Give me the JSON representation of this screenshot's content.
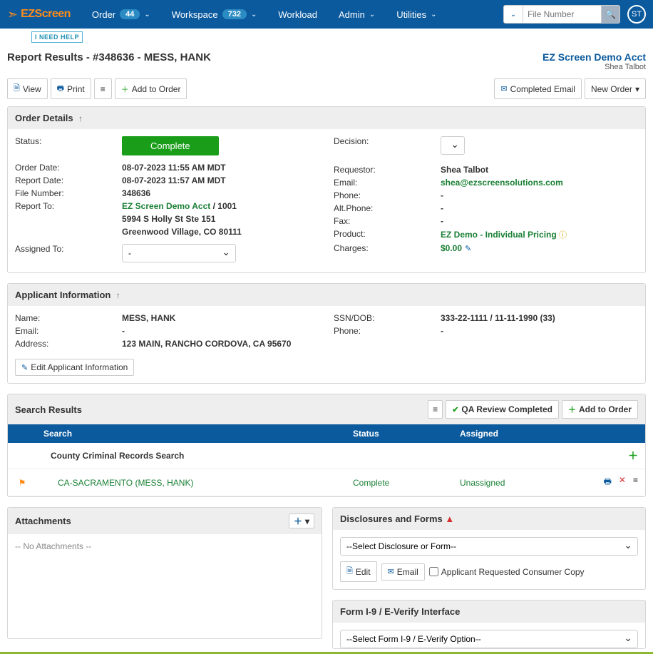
{
  "nav": {
    "logo": "EZScreen",
    "items": [
      {
        "label": "Order",
        "badge": "44"
      },
      {
        "label": "Workspace",
        "badge": "732"
      },
      {
        "label": "Workload"
      },
      {
        "label": "Admin"
      },
      {
        "label": "Utilities"
      }
    ],
    "search_placeholder": "File Number",
    "avatar": "ST"
  },
  "help_btn": "I NEED HELP",
  "page": {
    "title": "Report Results - #348636 - MESS, HANK",
    "account": "EZ Screen Demo Acct",
    "user": "Shea Talbot"
  },
  "toolbar": {
    "view": "View",
    "print": "Print",
    "add_to_order": "Add to Order",
    "completed_email": "Completed Email",
    "new_order": "New Order"
  },
  "order_details": {
    "title": "Order Details",
    "left": {
      "status_lbl": "Status:",
      "status_val": "Complete",
      "order_date_lbl": "Order Date:",
      "order_date_val": "08-07-2023 11:55 AM MDT",
      "report_date_lbl": "Report Date:",
      "report_date_val": "08-07-2023 11:57 AM MDT",
      "file_lbl": "File Number:",
      "file_val": "348636",
      "report_to_lbl": "Report To:",
      "report_to_acct": "EZ Screen Demo Acct",
      "report_to_rest": " / 1001",
      "addr1": "5994 S Holly St Ste 151",
      "addr2": "Greenwood Village, CO 80111",
      "assigned_lbl": "Assigned To:",
      "assigned_val": "-"
    },
    "right": {
      "decision_lbl": "Decision:",
      "requestor_lbl": "Requestor:",
      "requestor_val": "Shea Talbot",
      "email_lbl": "Email:",
      "email_val": "shea@ezscreensolutions.com",
      "phone_lbl": "Phone:",
      "phone_val": "-",
      "altphone_lbl": "Alt.Phone:",
      "altphone_val": "-",
      "fax_lbl": "Fax:",
      "fax_val": "-",
      "product_lbl": "Product:",
      "product_val": "EZ Demo - Individual Pricing",
      "charges_lbl": "Charges:",
      "charges_val": "$0.00"
    }
  },
  "applicant": {
    "title": "Applicant Information",
    "name_lbl": "Name:",
    "name_val": "MESS, HANK",
    "email_lbl": "Email:",
    "email_val": "-",
    "address_lbl": "Address:",
    "address_val": "123 MAIN, RANCHO CORDOVA, CA 95670",
    "ssn_lbl": "SSN/DOB:",
    "ssn_val": "333-22-1111 / 11-11-1990 (33)",
    "phone_lbl": "Phone:",
    "phone_val": "-",
    "edit_btn": "Edit Applicant Information"
  },
  "search_results": {
    "title": "Search Results",
    "qa_btn": "QA Review Completed",
    "add_btn": "Add to Order",
    "cols": {
      "search": "Search",
      "status": "Status",
      "assigned": "Assigned"
    },
    "group": "County Criminal Records Search",
    "item": {
      "name": "CA-SACRAMENTO (MESS, HANK)",
      "status": "Complete",
      "assigned": "Unassigned"
    }
  },
  "attachments": {
    "title": "Attachments",
    "none": "-- No Attachments --"
  },
  "disclosures": {
    "title": "Disclosures and Forms",
    "select_placeholder": "--Select Disclosure or Form--",
    "edit": "Edit",
    "email": "Email",
    "consumer_copy": "Applicant Requested Consumer Copy"
  },
  "i9": {
    "title": "Form I-9 / E-Verify Interface",
    "select_placeholder": "--Select Form I-9 / E-Verify Option--"
  }
}
